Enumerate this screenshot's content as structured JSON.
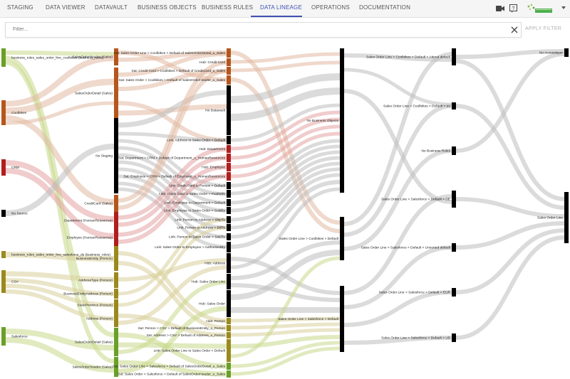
{
  "nav": {
    "tabs": [
      {
        "label": "STAGING",
        "active": false
      },
      {
        "label": "DATA VIEWER",
        "active": false
      },
      {
        "label": "DATAVAULT",
        "active": false
      },
      {
        "label": "BUSINESS OBJECTS",
        "active": false
      },
      {
        "label": "BUSINESS RULES",
        "active": false
      },
      {
        "label": "DATA LINEAGE",
        "active": true
      },
      {
        "label": "OPERATIONS",
        "active": false
      },
      {
        "label": "DOCUMENTATION",
        "active": false
      }
    ],
    "icons": [
      "video-camera-icon",
      "help-icon",
      "logo",
      "chevron-down-icon"
    ],
    "accent_color": "#3f51b5"
  },
  "filter": {
    "placeholder": "Filter...",
    "value": "",
    "apply_label": "APPLY FILTER"
  },
  "sankey": {
    "colors": {
      "green": "#6aa02a",
      "orange": "#b5561c",
      "red": "#b01e1e",
      "black": "#000000",
      "olive": "#9a8a1e",
      "lightgreen": "#c8d98a",
      "gray": "#bdbdbd",
      "peach": "#e2b9a3",
      "pink": "#e3a3a3",
      "olive_light": "#d9d09a"
    },
    "col0": [
      {
        "label": "business_rules_sales_order_line_coolbikes (business_rules)",
        "color": "green"
      },
      {
        "label": "Coolbikes",
        "color": "orange"
      },
      {
        "label": "CRM",
        "color": "red"
      },
      {
        "label": "No Source",
        "color": "black"
      },
      {
        "label": "business_rules_sales_order_line_salesforce_de (business_rules)",
        "color": "olive"
      },
      {
        "label": "CSV",
        "color": "olive"
      },
      {
        "label": "Salesforce",
        "color": "green"
      }
    ],
    "col1": [
      {
        "label": "SalesOrderHeader (Sales)",
        "color": "orange"
      },
      {
        "label": "SalesOrderDetail (Sales)",
        "color": "orange"
      },
      {
        "label": "No Staging",
        "color": "black"
      },
      {
        "label": "CreditCard (Sales)",
        "color": "orange"
      },
      {
        "label": "Department (HumanResources)",
        "color": "red"
      },
      {
        "label": "Employee (HumanResources)",
        "color": "red"
      },
      {
        "label": "BusinessEntity (Person)",
        "color": "olive"
      },
      {
        "label": "AddressType (Person)",
        "color": "olive"
      },
      {
        "label": "BusinessEntityAddress (Person)",
        "color": "olive"
      },
      {
        "label": "StateProvince (Person)",
        "color": "olive"
      },
      {
        "label": "Address (Person)",
        "color": "olive"
      },
      {
        "label": "SalesOrderDetail (Sales)",
        "color": "green"
      },
      {
        "label": "SalesOrderHeader (Sales)",
        "color": "green"
      }
    ],
    "col2": [
      {
        "label": "Sat: Sales Order Line > Coolbikes > Default of SalesOrderDetail_u_Sales",
        "color": "orange"
      },
      {
        "label": "Hub: Credit Card",
        "color": "orange"
      },
      {
        "label": "Sat: Credit Card > Coolbikes > Default of CreditCard_u_Sales",
        "color": "orange"
      },
      {
        "label": "Sat: Sales Order > Coolbikes > Default of SalesOrderHeader_u_Sales",
        "color": "orange"
      },
      {
        "label": "No Datavault",
        "color": "black"
      },
      {
        "label": "Link: Address to Sales Order > Default",
        "color": "black"
      },
      {
        "label": "Hub: Department",
        "color": "red"
      },
      {
        "label": "Sat: Department > CRM > Default of Department_u_HumanResources",
        "color": "red"
      },
      {
        "label": "Hub: Employee",
        "color": "red"
      },
      {
        "label": "Sat: Employee > CRM > Default of Employee_u_HumanResources",
        "color": "red"
      },
      {
        "label": "Link: Credit Card to Person > Default",
        "color": "black"
      },
      {
        "label": "Link: Credit Card to Sales Order > PaidWith",
        "color": "black"
      },
      {
        "label": "Link: Employee to Department > Default",
        "color": "black"
      },
      {
        "label": "Link: Employee to Sales Order > SoldBy",
        "color": "black"
      },
      {
        "label": "Link: Person to Address > ShipTo",
        "color": "black"
      },
      {
        "label": "Link: Person to Address > BillTo",
        "color": "black"
      },
      {
        "label": "Link: Person to Sales Order > SoldTo",
        "color": "black"
      },
      {
        "label": "Link: Sales Order to Employee > AuthorizedBy",
        "color": "black"
      },
      {
        "label": "Hub: Address",
        "color": "black"
      },
      {
        "label": "Hub: Sales Order Line",
        "color": "black"
      },
      {
        "label": "Hub: Sales Order",
        "color": "black"
      },
      {
        "label": "Hub: Person",
        "color": "olive"
      },
      {
        "label": "Sat: Person > CSV > Default of BusinessEntity_u_Person",
        "color": "olive"
      },
      {
        "label": "Sat: Address > CSV > Default of Address_u_Person",
        "color": "olive"
      },
      {
        "label": "Link: Sales Order Line to Sales Order > Default",
        "color": "olive"
      },
      {
        "label": "Sat: Sales Order Line > Salesforce > Default of SalesOrderDetail_u_Sales",
        "color": "green"
      },
      {
        "label": "Sat: Sales Order > Salesforce > Default of SalesOrderHeader_u_Sales",
        "color": "green"
      }
    ],
    "col3": [
      {
        "label": "No Business Objects",
        "color": "black"
      },
      {
        "label": "Sales Order Line > Coolbikes > Default",
        "color": "black"
      },
      {
        "label": "Sales Order Line > Salesforce > Default",
        "color": "black"
      }
    ],
    "col4": [
      {
        "label": "Sales Order Line > Coolbikes > Default > Attend default",
        "color": "black"
      },
      {
        "label": "Sales Order Line > Coolbikes > Default > eu",
        "color": "black"
      },
      {
        "label": "No Business Rules",
        "color": "black"
      },
      {
        "label": "Sales Order Line > Salesforce > Default > DE",
        "color": "black"
      },
      {
        "label": "Sales Order Line > Salesforce > Default > Unsorted default",
        "color": "black"
      },
      {
        "label": "Sales Order Line > Salesforce > Default > EUR",
        "color": "black"
      },
      {
        "label": "Sales Order Line > Salesforce > Default > US",
        "color": "black"
      }
    ],
    "col5": [
      {
        "label": "No Accesslayer",
        "color": "black"
      },
      {
        "label": "Sales Order Line",
        "color": "black"
      }
    ]
  }
}
